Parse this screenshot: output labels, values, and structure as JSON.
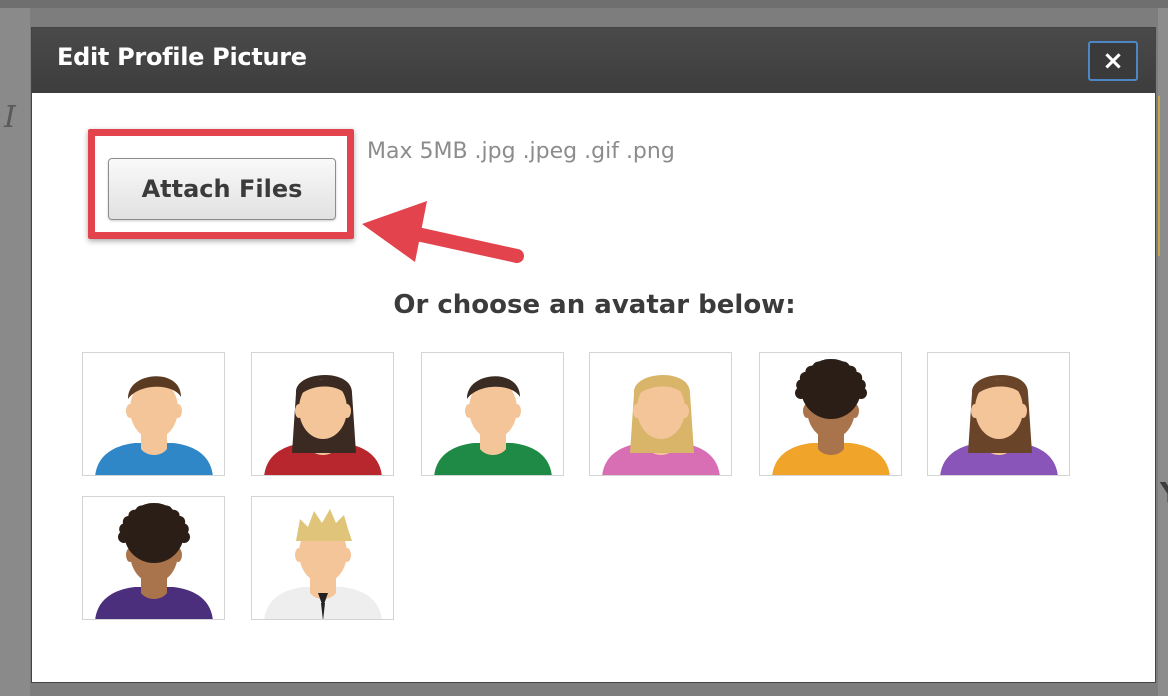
{
  "dialog": {
    "title": "Edit Profile Picture",
    "close_label": "×"
  },
  "upload": {
    "attach_label": "Attach Files",
    "hint": "Max 5MB .jpg .jpeg .gif .png"
  },
  "avatars": {
    "heading": "Or choose an avatar below:",
    "items": [
      {
        "skin": "#f5c59a",
        "hair": "#5b3a22",
        "shirt": "#2f87c8",
        "hair_style": "short"
      },
      {
        "skin": "#f5c59a",
        "hair": "#3b2a22",
        "shirt": "#b8262e",
        "hair_style": "long"
      },
      {
        "skin": "#f5c59a",
        "hair": "#3a2c22",
        "shirt": "#1f8a46",
        "hair_style": "short"
      },
      {
        "skin": "#f5c59a",
        "hair": "#d9b56a",
        "shirt": "#d86fb4",
        "hair_style": "long"
      },
      {
        "skin": "#a9744b",
        "hair": "#2a1e16",
        "shirt": "#f0a42a",
        "hair_style": "curly"
      },
      {
        "skin": "#f5c59a",
        "hair": "#6a4428",
        "shirt": "#8a55b8",
        "hair_style": "long"
      },
      {
        "skin": "#a9744b",
        "hair": "#2a1e16",
        "shirt": "#4b2f7c",
        "hair_style": "curly"
      },
      {
        "skin": "#f5c59a",
        "hair": "#e0c47a",
        "shirt": "#eeeeee",
        "hair_style": "spiky"
      }
    ]
  },
  "backdrop": {
    "left_glyph": "I",
    "right_glyph": "Y"
  },
  "colors": {
    "header_bg": "#404040",
    "highlight": "#e2434c",
    "close_border": "#4c86c6"
  }
}
